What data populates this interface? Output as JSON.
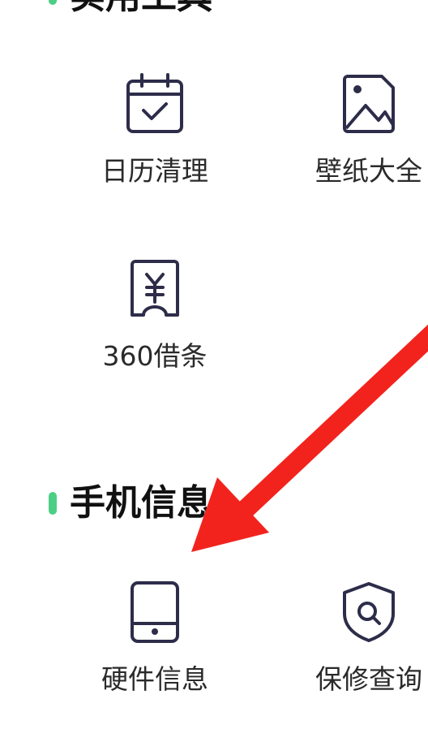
{
  "sections": [
    {
      "title": "实用工具",
      "items": [
        {
          "label": "日历清理",
          "icon": "calendar-check-icon"
        },
        {
          "label": "壁纸大全",
          "icon": "image-icon"
        },
        {
          "label": "360借条",
          "icon": "yuan-receipt-icon"
        }
      ]
    },
    {
      "title": "手机信息",
      "items": [
        {
          "label": "硬件信息",
          "icon": "tablet-icon"
        },
        {
          "label": "保修查询",
          "icon": "shield-search-icon"
        }
      ]
    }
  ],
  "colors": {
    "accent_dot": "#4ccf84",
    "icon_stroke": "#2d2d4a",
    "annotation_arrow": "#f2231d"
  }
}
